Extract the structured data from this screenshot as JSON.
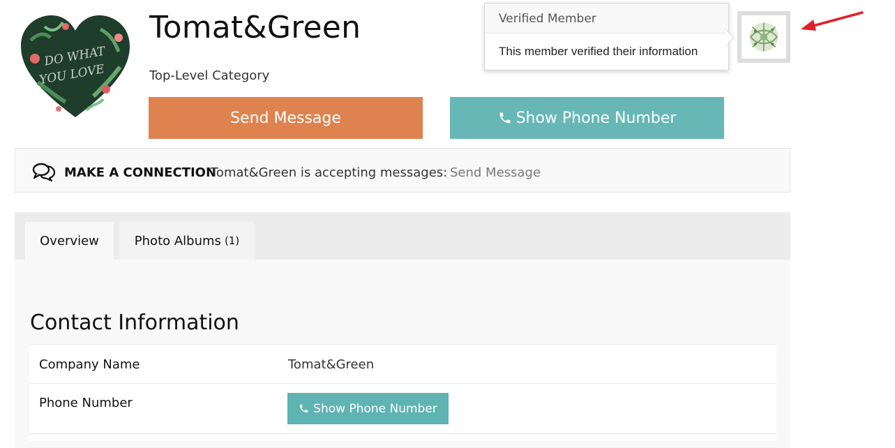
{
  "profile": {
    "name": "Tomat&Green",
    "category": "Top-Level Category",
    "logo_text": "DO WHAT YOU LOVE"
  },
  "buttons": {
    "send_message": "Send Message",
    "show_phone": "Show Phone Number"
  },
  "tooltip": {
    "title": "Verified Member",
    "body": "This member verified their information"
  },
  "connection": {
    "label": "MAKE A CONNECTION",
    "text": "Tomat&Green is accepting messages:",
    "link": "Send Message"
  },
  "tabs": [
    {
      "label": "Overview"
    },
    {
      "label": "Photo Albums",
      "count": "(1)"
    }
  ],
  "contact": {
    "title": "Contact Information",
    "rows": [
      {
        "label": "Company Name",
        "value": "Tomat&Green"
      },
      {
        "label": "Phone Number",
        "value": "Show Phone Number"
      }
    ]
  },
  "colors": {
    "send_button": "#de8350",
    "phone_button": "#66b7b6",
    "annotation_arrow": "#e0202a"
  },
  "icons": [
    "phone-icon",
    "chat-bubbles-icon",
    "verified-badge-icon",
    "arrow-annotation-icon"
  ]
}
